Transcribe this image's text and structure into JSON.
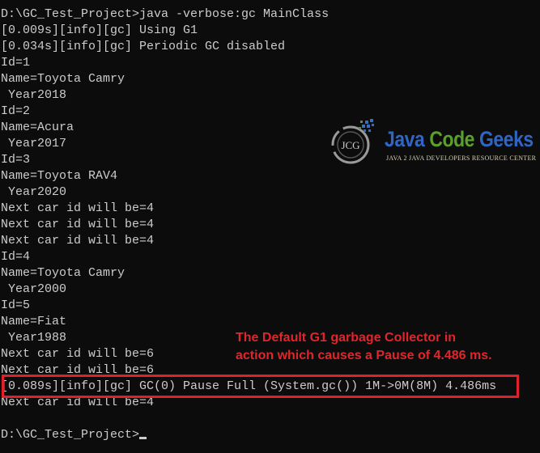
{
  "console": {
    "lines": [
      "D:\\GC_Test_Project>java -verbose:gc MainClass",
      "[0.009s][info][gc] Using G1",
      "[0.034s][info][gc] Periodic GC disabled",
      "Id=1",
      "Name=Toyota Camry",
      " Year2018",
      "Id=2",
      "Name=Acura",
      " Year2017",
      "Id=3",
      "Name=Toyota RAV4",
      " Year2020",
      "Next car id will be=4",
      "Next car id will be=4",
      "Next car id will be=4",
      "Id=4",
      "Name=Toyota Camry",
      " Year2000",
      "Id=5",
      "Name=Fiat",
      " Year1988",
      "Next car id will be=6",
      "Next car id will be=6",
      "[0.089s][info][gc] GC(0) Pause Full (System.gc()) 1M->0M(8M) 4.486ms",
      "Next car id will be=4",
      "",
      "D:\\GC_Test_Project>"
    ]
  },
  "annotation": {
    "line1": "The Default G1 garbage Collector in",
    "line2": "action which causes a Pause of 4.486 ms.",
    "color": "#e0252b"
  },
  "logo": {
    "monogram": "JCG",
    "word1": "Java",
    "word2": "Code",
    "word3": "Geeks",
    "tagline": "JAVA 2 JAVA DEVELOPERS RESOURCE CENTER"
  }
}
